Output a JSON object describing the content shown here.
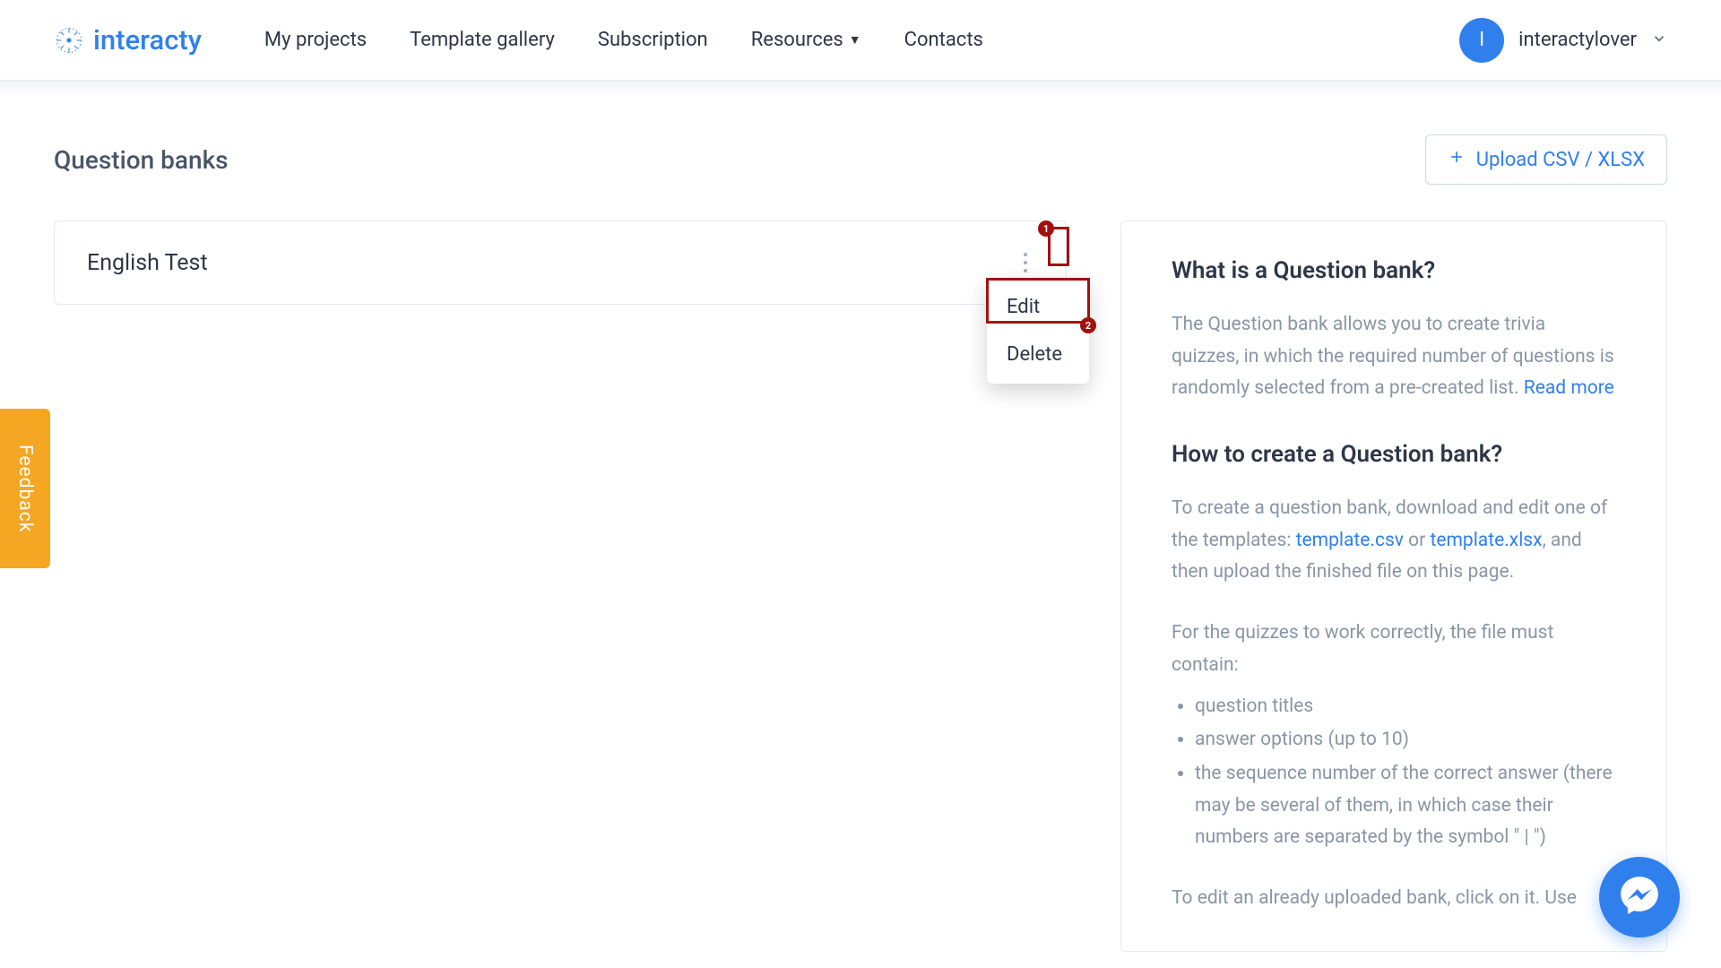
{
  "brand": {
    "name": "interacty"
  },
  "nav": {
    "items": [
      {
        "label": "My projects"
      },
      {
        "label": "Template gallery"
      },
      {
        "label": "Subscription"
      },
      {
        "label": "Resources",
        "hasCaret": true
      },
      {
        "label": "Contacts"
      }
    ]
  },
  "user": {
    "initial": "I",
    "name": "interactylover"
  },
  "page": {
    "title": "Question banks",
    "uploadLabel": "Upload CSV / XLSX"
  },
  "bank": {
    "title": "English Test",
    "menu": {
      "edit": "Edit",
      "delete": "Delete"
    }
  },
  "annotations": {
    "badge1": "1",
    "badge2": "2"
  },
  "info": {
    "h1": "What is a Question bank?",
    "p1a": "The Question bank allows you to create trivia quizzes, in which the required number of questions is randomly selected from a pre-created list. ",
    "p1link": "Read more",
    "h2": "How to create a Question bank?",
    "p2a": "To create a question bank, download and edit one of the templates: ",
    "p2link1": "template.csv",
    "p2mid": " or ",
    "p2link2": "template.xlsx",
    "p2b": ", and then upload the finished file on this page.",
    "p3": "For the quizzes to work correctly, the file must contain:",
    "li1": "question titles",
    "li2": "answer options (up to 10)",
    "li3": "the sequence number of the correct answer (there may be several of them, in which case their numbers are separated by the symbol \" | \")",
    "p4cut": "To edit an already uploaded bank, click on it. Use"
  },
  "feedback": {
    "label": "Feedback"
  }
}
